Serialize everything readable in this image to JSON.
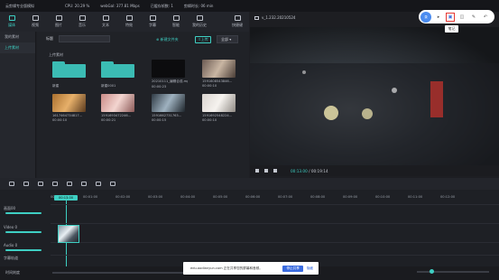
{
  "top_bar": {
    "app_title": "云剪辑专业版模拟",
    "cpu": "CPU: 20.29 %",
    "memory": "webGal: 377.81 Mbps",
    "frame_count": "已缓存帧数: 1",
    "duration": "剪辑时长: 06 min"
  },
  "main_toolbar": {
    "tools": [
      {
        "label": "媒体",
        "icon": "media-icon"
      },
      {
        "label": "视频",
        "icon": "video-icon"
      },
      {
        "label": "图片",
        "icon": "image-icon"
      },
      {
        "label": "音乐",
        "icon": "music-icon"
      },
      {
        "label": "文本",
        "icon": "text-icon"
      },
      {
        "label": "特效",
        "icon": "effects-icon"
      },
      {
        "label": "字幕",
        "icon": "subtitle-icon"
      },
      {
        "label": "智能",
        "icon": "smart-icon"
      },
      {
        "label": "我的历史",
        "icon": "history-icon"
      }
    ],
    "right_tool": {
      "label": "快捷键",
      "icon": "keyboard-icon"
    }
  },
  "sidebar": {
    "items": [
      "我的素材",
      "上传素材"
    ]
  },
  "media_panel": {
    "search_label": "标题",
    "new_folder": "新建文件夹",
    "upload": "上传",
    "sort": "全部",
    "section": "上传素材",
    "items": [
      {
        "kind": "folder",
        "name": "新建",
        "duration": ""
      },
      {
        "kind": "folder",
        "name": "新建0001",
        "duration": ""
      },
      {
        "kind": "video",
        "name": "20210111_编辑合成.mp4",
        "duration": "00:00:23"
      },
      {
        "kind": "video",
        "name": "1591608543846...",
        "duration": "00:00:10"
      },
      {
        "kind": "video",
        "name": "1617464734817...",
        "duration": "00:00:10"
      },
      {
        "kind": "video",
        "name": "1591693472246...",
        "duration": "00:00:21"
      },
      {
        "kind": "video",
        "name": "1591662731763...",
        "duration": "00:00:15"
      },
      {
        "kind": "video",
        "name": "1591692548224...",
        "duration": "00:00:10"
      }
    ]
  },
  "preview": {
    "title": "v_1.232.20210524",
    "current_time": "00:13.00",
    "total_time": "00:19:14"
  },
  "record_bar": {
    "logo": "录",
    "tooltip": "笔记"
  },
  "timeline": {
    "playhead_time": "00:13.00",
    "ticks": [
      "00:00:00",
      "00:01:00",
      "00:02:00",
      "00:03:00",
      "00:04:00",
      "00:05:00",
      "00:06:00",
      "00:07:00",
      "00:08:00",
      "00:09:00",
      "00:10:00",
      "00:11:00",
      "00:12:00"
    ],
    "tracks": [
      {
        "label": "画面00"
      },
      {
        "label": "Video 0"
      },
      {
        "label": "Audio 0"
      },
      {
        "label": "字幕轨道"
      }
    ],
    "bottom_label": "时间刻度"
  },
  "notice": {
    "text": "edu.aodianyun.com 正在共享您的屏幕和音频。",
    "stop": "停止共享",
    "hide": "隐藏"
  },
  "colors": {
    "accent": "#3ecfc3",
    "record": "#e53935",
    "link": "#3a6be0"
  }
}
